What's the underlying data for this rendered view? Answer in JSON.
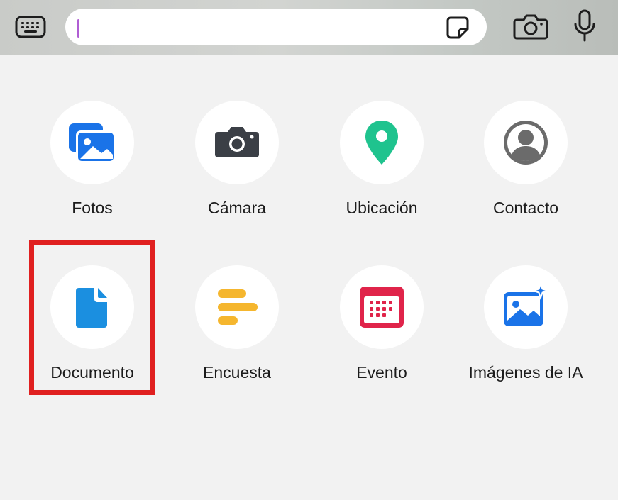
{
  "topbar": {
    "search": {
      "value": "",
      "placeholder": ""
    }
  },
  "attachments": [
    {
      "label": "Fotos"
    },
    {
      "label": "Cámara"
    },
    {
      "label": "Ubicación"
    },
    {
      "label": "Contacto"
    },
    {
      "label": "Documento"
    },
    {
      "label": "Encuesta"
    },
    {
      "label": "Evento"
    },
    {
      "label": "Imágenes de IA"
    }
  ],
  "highlighted_item": "Documento",
  "colors": {
    "highlight": "#e02020",
    "fotos": "#1a73e8",
    "camara": "#3b3f46",
    "ubicacion": "#1fc38e",
    "contacto": "#6b6b6b",
    "documento": "#1b8fe0",
    "encuesta": "#f5b62e",
    "evento": "#e0244a",
    "imagenes_ia": "#1a73e8"
  }
}
